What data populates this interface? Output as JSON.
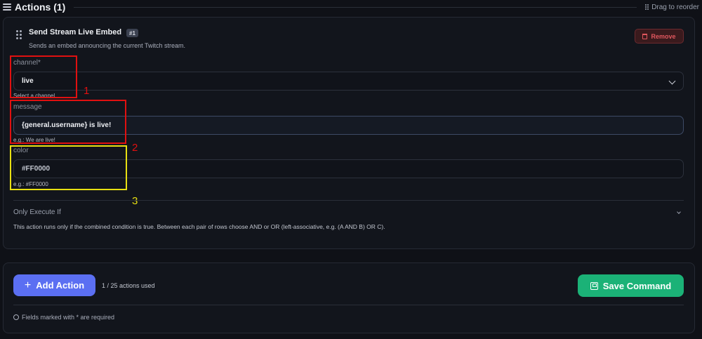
{
  "header": {
    "title": "Actions (1)",
    "drag_hint": "Drag to reorder"
  },
  "action": {
    "title": "Send Stream Live Embed",
    "badge": "#1",
    "description": "Sends an embed announcing the current Twitch stream.",
    "remove_label": "Remove",
    "fields": {
      "channel": {
        "label": "channel*",
        "value": "live",
        "hint": "Select a channel"
      },
      "message": {
        "label": "message",
        "value": "{general.username} is live!",
        "hint": "e.g.: We are live!"
      },
      "color": {
        "label": "color",
        "value": "#FF0000",
        "hint": "e.g.: #FF0000"
      }
    },
    "only_execute": {
      "title": "Only Execute If",
      "description": "This action runs only if the combined condition is true. Between each pair of rows choose AND or OR (left-associative, e.g. (A AND B) OR C)."
    }
  },
  "annotations": [
    "1",
    "2",
    "3"
  ],
  "footer": {
    "add_label": "Add Action",
    "used_text": "1 / 25 actions used",
    "save_label": "Save Command",
    "required_note": "Fields marked with * are required"
  },
  "colors": {
    "add_button": "#5b6ff2",
    "save_button": "#1bb277",
    "remove_text": "#e0575e",
    "annotation_red": "#e01010",
    "annotation_yellow": "#e8e012"
  }
}
